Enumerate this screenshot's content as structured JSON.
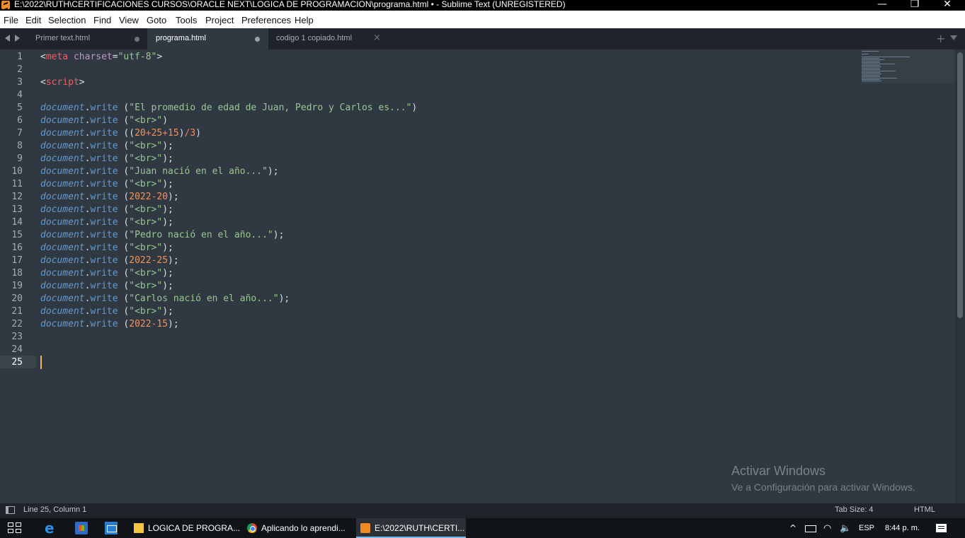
{
  "window": {
    "title": "E:\\2022\\RUTH\\CERTIFICACIONES CURSOS\\ORACLE NEXT\\LOGICA DE PROGRAMACION\\programa.html • - Sublime Text (UNREGISTERED)",
    "minimize": "—",
    "restore": "❐",
    "close": "✕"
  },
  "menu": [
    "File",
    "Edit",
    "Selection",
    "Find",
    "View",
    "Goto",
    "Tools",
    "Project",
    "Preferences",
    "Help"
  ],
  "tabs": [
    {
      "label": "Primer text.html",
      "state": "dirty"
    },
    {
      "label": "programa.html",
      "state": "dirty-active"
    },
    {
      "label": "codigo 1 copiado.html",
      "state": "close"
    }
  ],
  "tab_controls": {
    "new_tab": "+",
    "close_glyph": "×"
  },
  "editor": {
    "line_numbers": [
      "1",
      "2",
      "3",
      "4",
      "5",
      "6",
      "7",
      "8",
      "9",
      "10",
      "11",
      "12",
      "13",
      "14",
      "15",
      "16",
      "17",
      "18",
      "19",
      "20",
      "21",
      "22",
      "23",
      "24",
      "25"
    ],
    "current_line": 25,
    "lines": [
      [
        {
          "t": "<",
          "c": "tag"
        },
        {
          "t": "meta",
          "c": "tagname"
        },
        {
          "t": " ",
          "c": "punc"
        },
        {
          "t": "charset",
          "c": "attr"
        },
        {
          "t": "=",
          "c": "punc"
        },
        {
          "t": "\"utf-8\"",
          "c": "str"
        },
        {
          "t": ">",
          "c": "tag"
        }
      ],
      [],
      [
        {
          "t": "<",
          "c": "tag"
        },
        {
          "t": "script",
          "c": "tagname"
        },
        {
          "t": ">",
          "c": "tag"
        }
      ],
      [],
      [
        {
          "t": "document",
          "c": "obj"
        },
        {
          "t": ".",
          "c": "dot"
        },
        {
          "t": "write",
          "c": "fn"
        },
        {
          "t": " (",
          "c": "punc"
        },
        {
          "t": "\"El promedio de edad de Juan, Pedro y Carlos es...\"",
          "c": "str"
        },
        {
          "t": ")",
          "c": "punc"
        }
      ],
      [
        {
          "t": "document",
          "c": "obj"
        },
        {
          "t": ".",
          "c": "dot"
        },
        {
          "t": "write",
          "c": "fn"
        },
        {
          "t": " (",
          "c": "punc"
        },
        {
          "t": "\"<br>\"",
          "c": "str"
        },
        {
          "t": ")",
          "c": "punc"
        }
      ],
      [
        {
          "t": "document",
          "c": "obj"
        },
        {
          "t": ".",
          "c": "dot"
        },
        {
          "t": "write",
          "c": "fn"
        },
        {
          "t": " ((",
          "c": "punc"
        },
        {
          "t": "20",
          "c": "num"
        },
        {
          "t": "+",
          "c": "op"
        },
        {
          "t": "25",
          "c": "num"
        },
        {
          "t": "+",
          "c": "op"
        },
        {
          "t": "15",
          "c": "num"
        },
        {
          "t": ")",
          "c": "punc"
        },
        {
          "t": "/",
          "c": "op"
        },
        {
          "t": "3",
          "c": "num"
        },
        {
          "t": ")",
          "c": "punc"
        }
      ],
      [
        {
          "t": "document",
          "c": "obj"
        },
        {
          "t": ".",
          "c": "dot"
        },
        {
          "t": "write",
          "c": "fn"
        },
        {
          "t": " (",
          "c": "punc"
        },
        {
          "t": "\"<br>\"",
          "c": "str"
        },
        {
          "t": ");",
          "c": "punc"
        }
      ],
      [
        {
          "t": "document",
          "c": "obj"
        },
        {
          "t": ".",
          "c": "dot"
        },
        {
          "t": "write",
          "c": "fn"
        },
        {
          "t": " (",
          "c": "punc"
        },
        {
          "t": "\"<br>\"",
          "c": "str"
        },
        {
          "t": ");",
          "c": "punc"
        }
      ],
      [
        {
          "t": "document",
          "c": "obj"
        },
        {
          "t": ".",
          "c": "dot"
        },
        {
          "t": "write",
          "c": "fn"
        },
        {
          "t": " (",
          "c": "punc"
        },
        {
          "t": "\"Juan nació en el año...\"",
          "c": "str"
        },
        {
          "t": ");",
          "c": "punc"
        }
      ],
      [
        {
          "t": "document",
          "c": "obj"
        },
        {
          "t": ".",
          "c": "dot"
        },
        {
          "t": "write",
          "c": "fn"
        },
        {
          "t": " (",
          "c": "punc"
        },
        {
          "t": "\"<br>\"",
          "c": "str"
        },
        {
          "t": ");",
          "c": "punc"
        }
      ],
      [
        {
          "t": "document",
          "c": "obj"
        },
        {
          "t": ".",
          "c": "dot"
        },
        {
          "t": "write",
          "c": "fn"
        },
        {
          "t": " (",
          "c": "punc"
        },
        {
          "t": "2022",
          "c": "num"
        },
        {
          "t": "-",
          "c": "op"
        },
        {
          "t": "20",
          "c": "num"
        },
        {
          "t": ");",
          "c": "punc"
        }
      ],
      [
        {
          "t": "document",
          "c": "obj"
        },
        {
          "t": ".",
          "c": "dot"
        },
        {
          "t": "write",
          "c": "fn"
        },
        {
          "t": " (",
          "c": "punc"
        },
        {
          "t": "\"<br>\"",
          "c": "str"
        },
        {
          "t": ");",
          "c": "punc"
        }
      ],
      [
        {
          "t": "document",
          "c": "obj"
        },
        {
          "t": ".",
          "c": "dot"
        },
        {
          "t": "write",
          "c": "fn"
        },
        {
          "t": " (",
          "c": "punc"
        },
        {
          "t": "\"<br>\"",
          "c": "str"
        },
        {
          "t": ");",
          "c": "punc"
        }
      ],
      [
        {
          "t": "document",
          "c": "obj"
        },
        {
          "t": ".",
          "c": "dot"
        },
        {
          "t": "write",
          "c": "fn"
        },
        {
          "t": " (",
          "c": "punc"
        },
        {
          "t": "\"Pedro nació en el año...\"",
          "c": "str"
        },
        {
          "t": ");",
          "c": "punc"
        }
      ],
      [
        {
          "t": "document",
          "c": "obj"
        },
        {
          "t": ".",
          "c": "dot"
        },
        {
          "t": "write",
          "c": "fn"
        },
        {
          "t": " (",
          "c": "punc"
        },
        {
          "t": "\"<br>\"",
          "c": "str"
        },
        {
          "t": ");",
          "c": "punc"
        }
      ],
      [
        {
          "t": "document",
          "c": "obj"
        },
        {
          "t": ".",
          "c": "dot"
        },
        {
          "t": "write",
          "c": "fn"
        },
        {
          "t": " (",
          "c": "punc"
        },
        {
          "t": "2022",
          "c": "num"
        },
        {
          "t": "-",
          "c": "op"
        },
        {
          "t": "25",
          "c": "num"
        },
        {
          "t": ");",
          "c": "punc"
        }
      ],
      [
        {
          "t": "document",
          "c": "obj"
        },
        {
          "t": ".",
          "c": "dot"
        },
        {
          "t": "write",
          "c": "fn"
        },
        {
          "t": " (",
          "c": "punc"
        },
        {
          "t": "\"<br>\"",
          "c": "str"
        },
        {
          "t": ");",
          "c": "punc"
        }
      ],
      [
        {
          "t": "document",
          "c": "obj"
        },
        {
          "t": ".",
          "c": "dot"
        },
        {
          "t": "write",
          "c": "fn"
        },
        {
          "t": " (",
          "c": "punc"
        },
        {
          "t": "\"<br>\"",
          "c": "str"
        },
        {
          "t": ");",
          "c": "punc"
        }
      ],
      [
        {
          "t": "document",
          "c": "obj"
        },
        {
          "t": ".",
          "c": "dot"
        },
        {
          "t": "write",
          "c": "fn"
        },
        {
          "t": " (",
          "c": "punc"
        },
        {
          "t": "\"Carlos nació en el año...\"",
          "c": "str"
        },
        {
          "t": ");",
          "c": "punc"
        }
      ],
      [
        {
          "t": "document",
          "c": "obj"
        },
        {
          "t": ".",
          "c": "dot"
        },
        {
          "t": "write",
          "c": "fn"
        },
        {
          "t": " (",
          "c": "punc"
        },
        {
          "t": "\"<br>\"",
          "c": "str"
        },
        {
          "t": ");",
          "c": "punc"
        }
      ],
      [
        {
          "t": "document",
          "c": "obj"
        },
        {
          "t": ".",
          "c": "dot"
        },
        {
          "t": "write",
          "c": "fn"
        },
        {
          "t": " (",
          "c": "punc"
        },
        {
          "t": "2022",
          "c": "num"
        },
        {
          "t": "-",
          "c": "op"
        },
        {
          "t": "15",
          "c": "num"
        },
        {
          "t": ");",
          "c": "punc"
        }
      ],
      [],
      [],
      []
    ]
  },
  "watermark": {
    "title": "Activar Windows",
    "subtitle": "Ve a Configuración para activar Windows."
  },
  "status": {
    "position": "Line 25, Column 1",
    "tab_size": "Tab Size: 4",
    "syntax": "HTML"
  },
  "taskbar": {
    "apps": [
      {
        "label": "LOGICA DE PROGRA...",
        "icon": "folder-icon",
        "active": false
      },
      {
        "label": "Aplicando lo aprendi...",
        "icon": "chrome-icon",
        "active": false
      },
      {
        "label": "E:\\2022\\RUTH\\CERTI...",
        "icon": "sublime-icon",
        "active": true
      }
    ],
    "tray": {
      "chevron": "^",
      "wifi": "◠",
      "volume": "🔈",
      "language": "ESP",
      "time": "8:44 p. m."
    }
  },
  "colors": {
    "editor_bg": "#303841",
    "tab_bar_bg": "#1e242a",
    "string": "#99c794",
    "number": "#f99157",
    "keyword_obj": "#6699cc",
    "tag": "#ec5f67",
    "attr": "#c594c5",
    "caret": "#f9ae58"
  }
}
